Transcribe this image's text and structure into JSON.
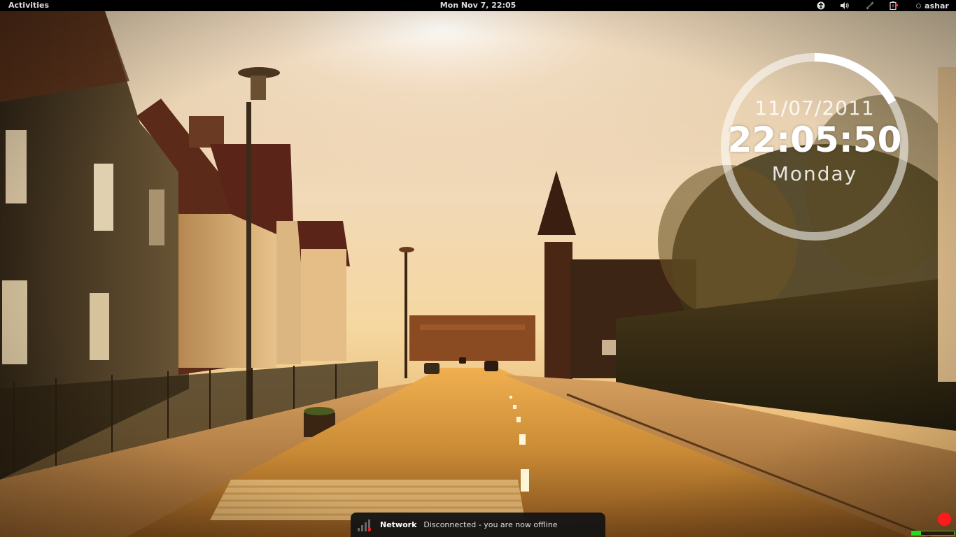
{
  "topbar": {
    "activities_label": "Activities",
    "clock": "Mon Nov  7, 22:05",
    "user_name": "ashar",
    "icons": [
      "accessibility-icon",
      "volume-icon",
      "network-icon",
      "battery-icon",
      "user-status-icon"
    ]
  },
  "clock_widget": {
    "date": "11/07/2011",
    "time": "22:05:50",
    "day": "Monday",
    "seconds_progress": 0.833
  },
  "notification": {
    "icon": "network-signal-offline-icon",
    "title": "Network",
    "body": "Disconnected - you are now offline"
  },
  "message_tray": {
    "indicator_color": "#ff1a1a",
    "activity_level": 0.22
  },
  "colors": {
    "topbar_bg": "#000000",
    "notification_bg": "#141414",
    "indicator_green": "#22dd22"
  }
}
